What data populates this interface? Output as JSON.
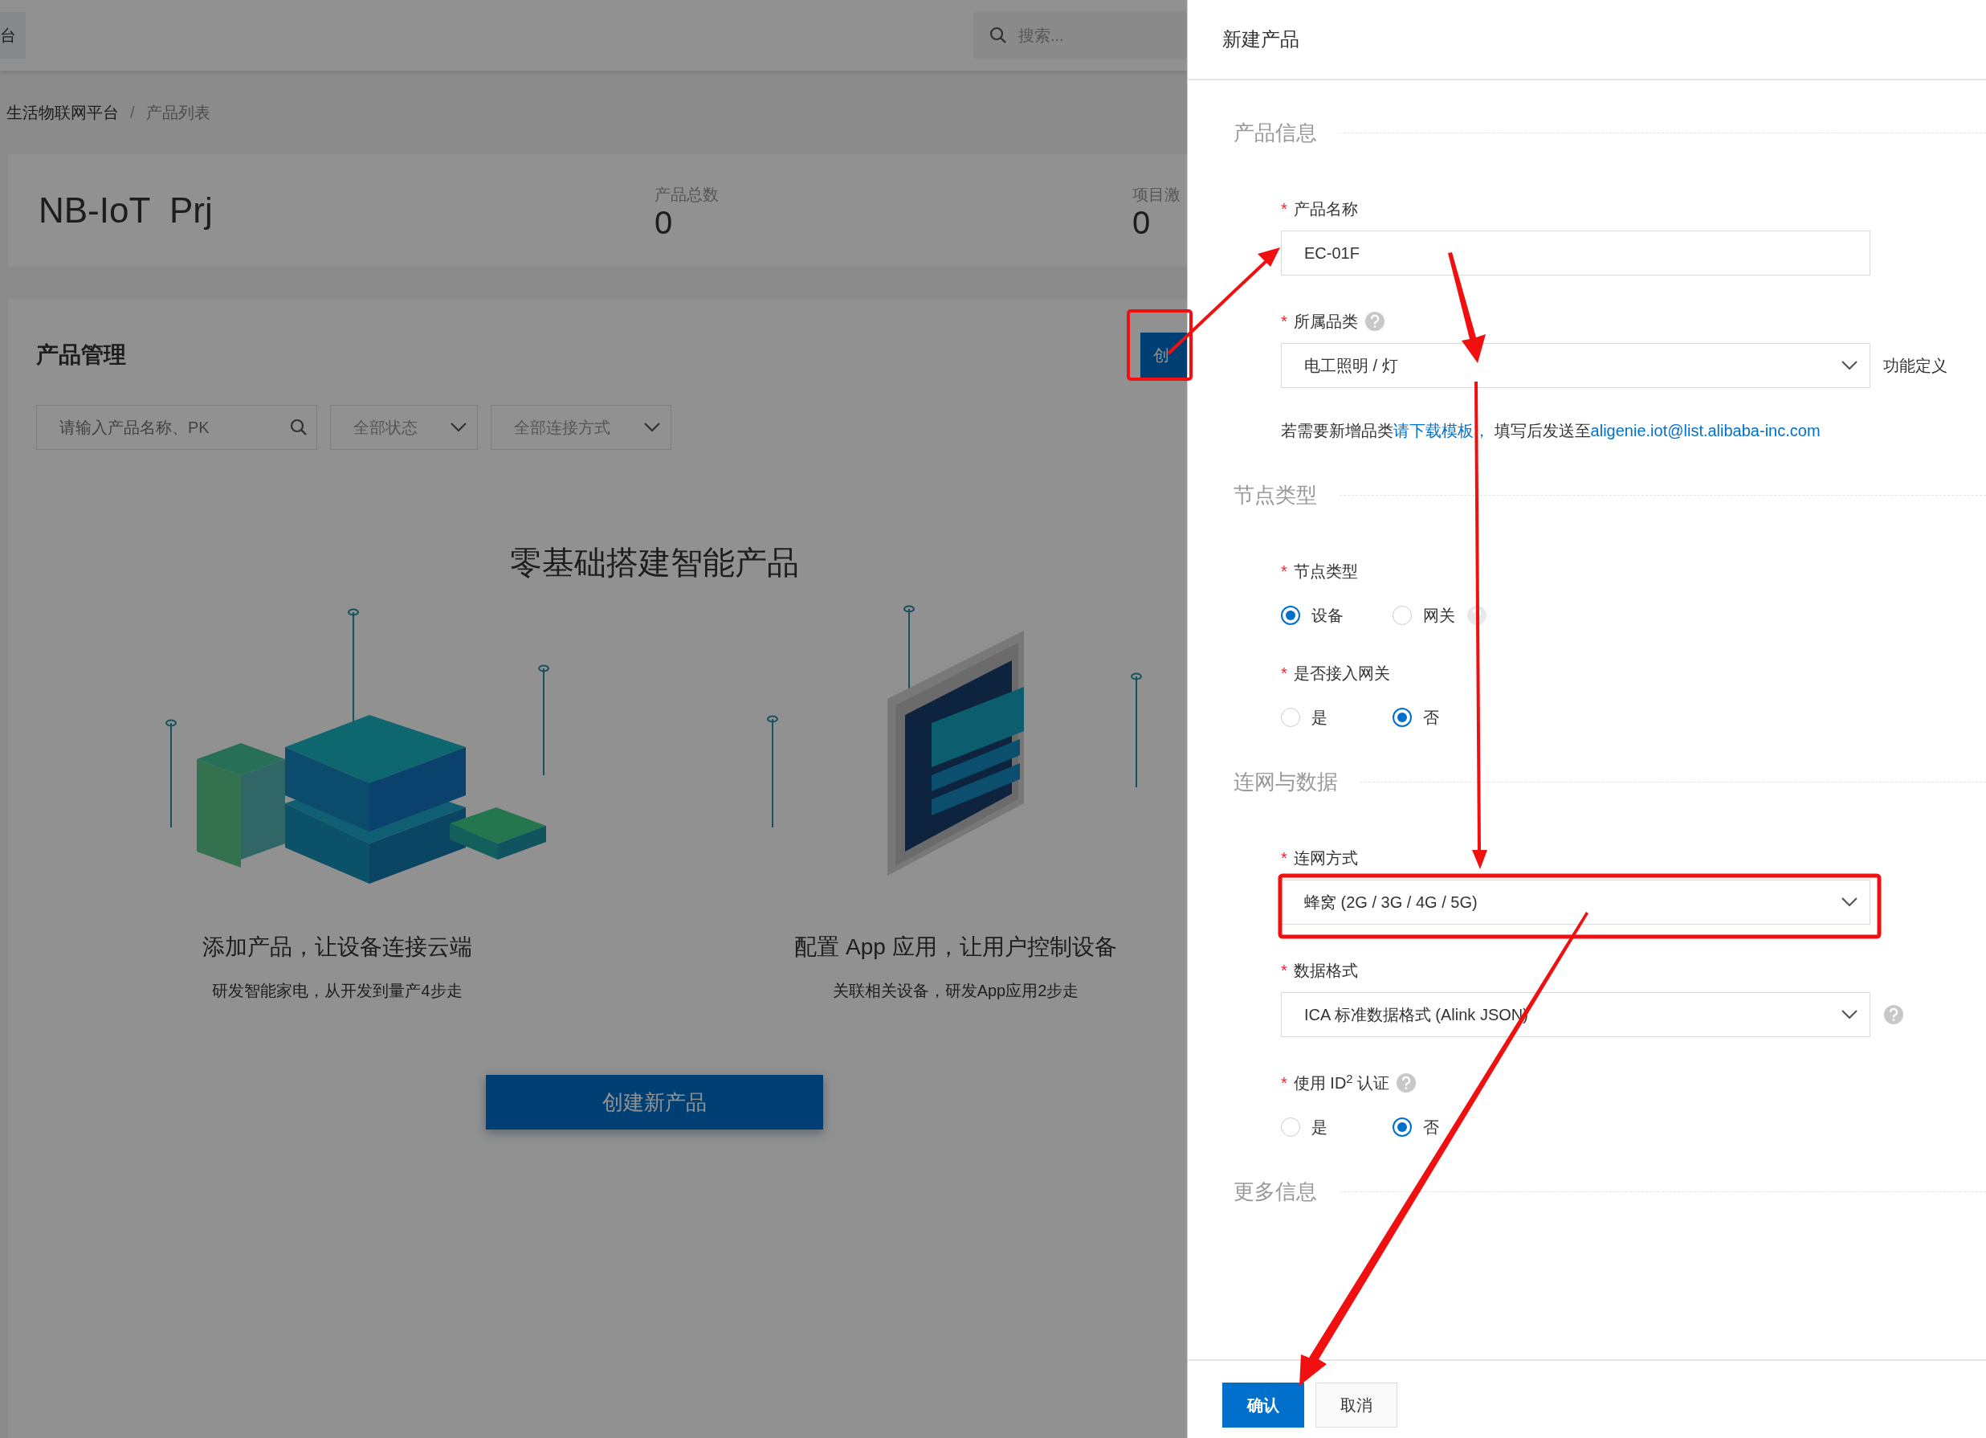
{
  "topbar": {
    "tab_label": "台",
    "search": {
      "placeholder": "搜索..."
    }
  },
  "breadcrumb": {
    "separator": "/",
    "items": [
      {
        "label": "生活物联网平台",
        "current": false
      },
      {
        "label": "产品列表",
        "current": true
      }
    ]
  },
  "project": {
    "name": "NB-IoT  Prj",
    "stats": [
      {
        "label": "产品总数",
        "value": "0"
      },
      {
        "label": "项目激",
        "value": "0"
      }
    ]
  },
  "product_panel": {
    "title": "产品管理",
    "create_button": "创",
    "search": {
      "placeholder": "请输入产品名称、PK"
    },
    "filters": [
      "全部状态",
      "全部连接方式"
    ],
    "empty_state": {
      "heading": "零基础搭建智能产品",
      "cards": [
        {
          "kind": "cubes",
          "title": "添加产品，让设备连接云端",
          "subtitle": "研发智能家电，从开发到量产4步走"
        },
        {
          "kind": "tablet",
          "title": "配置 App 应用，让用户控制设备",
          "subtitle": "关联相关设备，研发App应用2步走"
        }
      ],
      "button": "创建新产品"
    }
  },
  "drawer": {
    "title": "新建产品",
    "required_mark": "*",
    "sections": [
      {
        "title": "产品信息",
        "fields": [
          {
            "kind": "text",
            "label": "产品名称",
            "required": true,
            "value": "EC-01F"
          },
          {
            "kind": "select",
            "label": "所属品类",
            "required": true,
            "help": true,
            "value": "电工照明 / 灯",
            "suffix": "功能定义",
            "note": [
              {
                "text": "若需要新增品类",
                "link": false
              },
              {
                "text": "请下载模板，",
                "link": true
              },
              {
                "text": " 填写后发送至",
                "link": false
              },
              {
                "text": "aligenie.iot@list.alibaba-inc.com",
                "link": true
              }
            ]
          }
        ]
      },
      {
        "title": "节点类型",
        "fields": [
          {
            "kind": "radio",
            "label": "节点类型",
            "required": true,
            "options": [
              {
                "label": "设备",
                "selected": true,
                "help": false
              },
              {
                "label": "网关",
                "selected": false,
                "help": true
              }
            ]
          },
          {
            "kind": "radio",
            "label": "是否接入网关",
            "required": true,
            "options": [
              {
                "label": "是",
                "selected": false,
                "help": false
              },
              {
                "label": "否",
                "selected": true,
                "help": false
              }
            ]
          }
        ]
      },
      {
        "title": "连网与数据",
        "fields": [
          {
            "kind": "select",
            "label": "连网方式",
            "required": true,
            "value": "蜂窝 (2G / 3G / 4G / 5G)"
          },
          {
            "kind": "select",
            "label": "数据格式",
            "required": true,
            "value": "ICA 标准数据格式 (Alink JSON)",
            "side_help": true
          },
          {
            "kind": "radio",
            "label": "使用 ID$^{2}$ 认证",
            "required": true,
            "help": true,
            "options": [
              {
                "label": "是",
                "selected": false,
                "help": false
              },
              {
                "label": "否",
                "selected": true,
                "help": false
              }
            ]
          }
        ]
      },
      {
        "title": "更多信息"
      }
    ],
    "buttons": [
      {
        "label": "确认",
        "primary": true
      },
      {
        "label": "取消",
        "primary": false
      }
    ]
  }
}
